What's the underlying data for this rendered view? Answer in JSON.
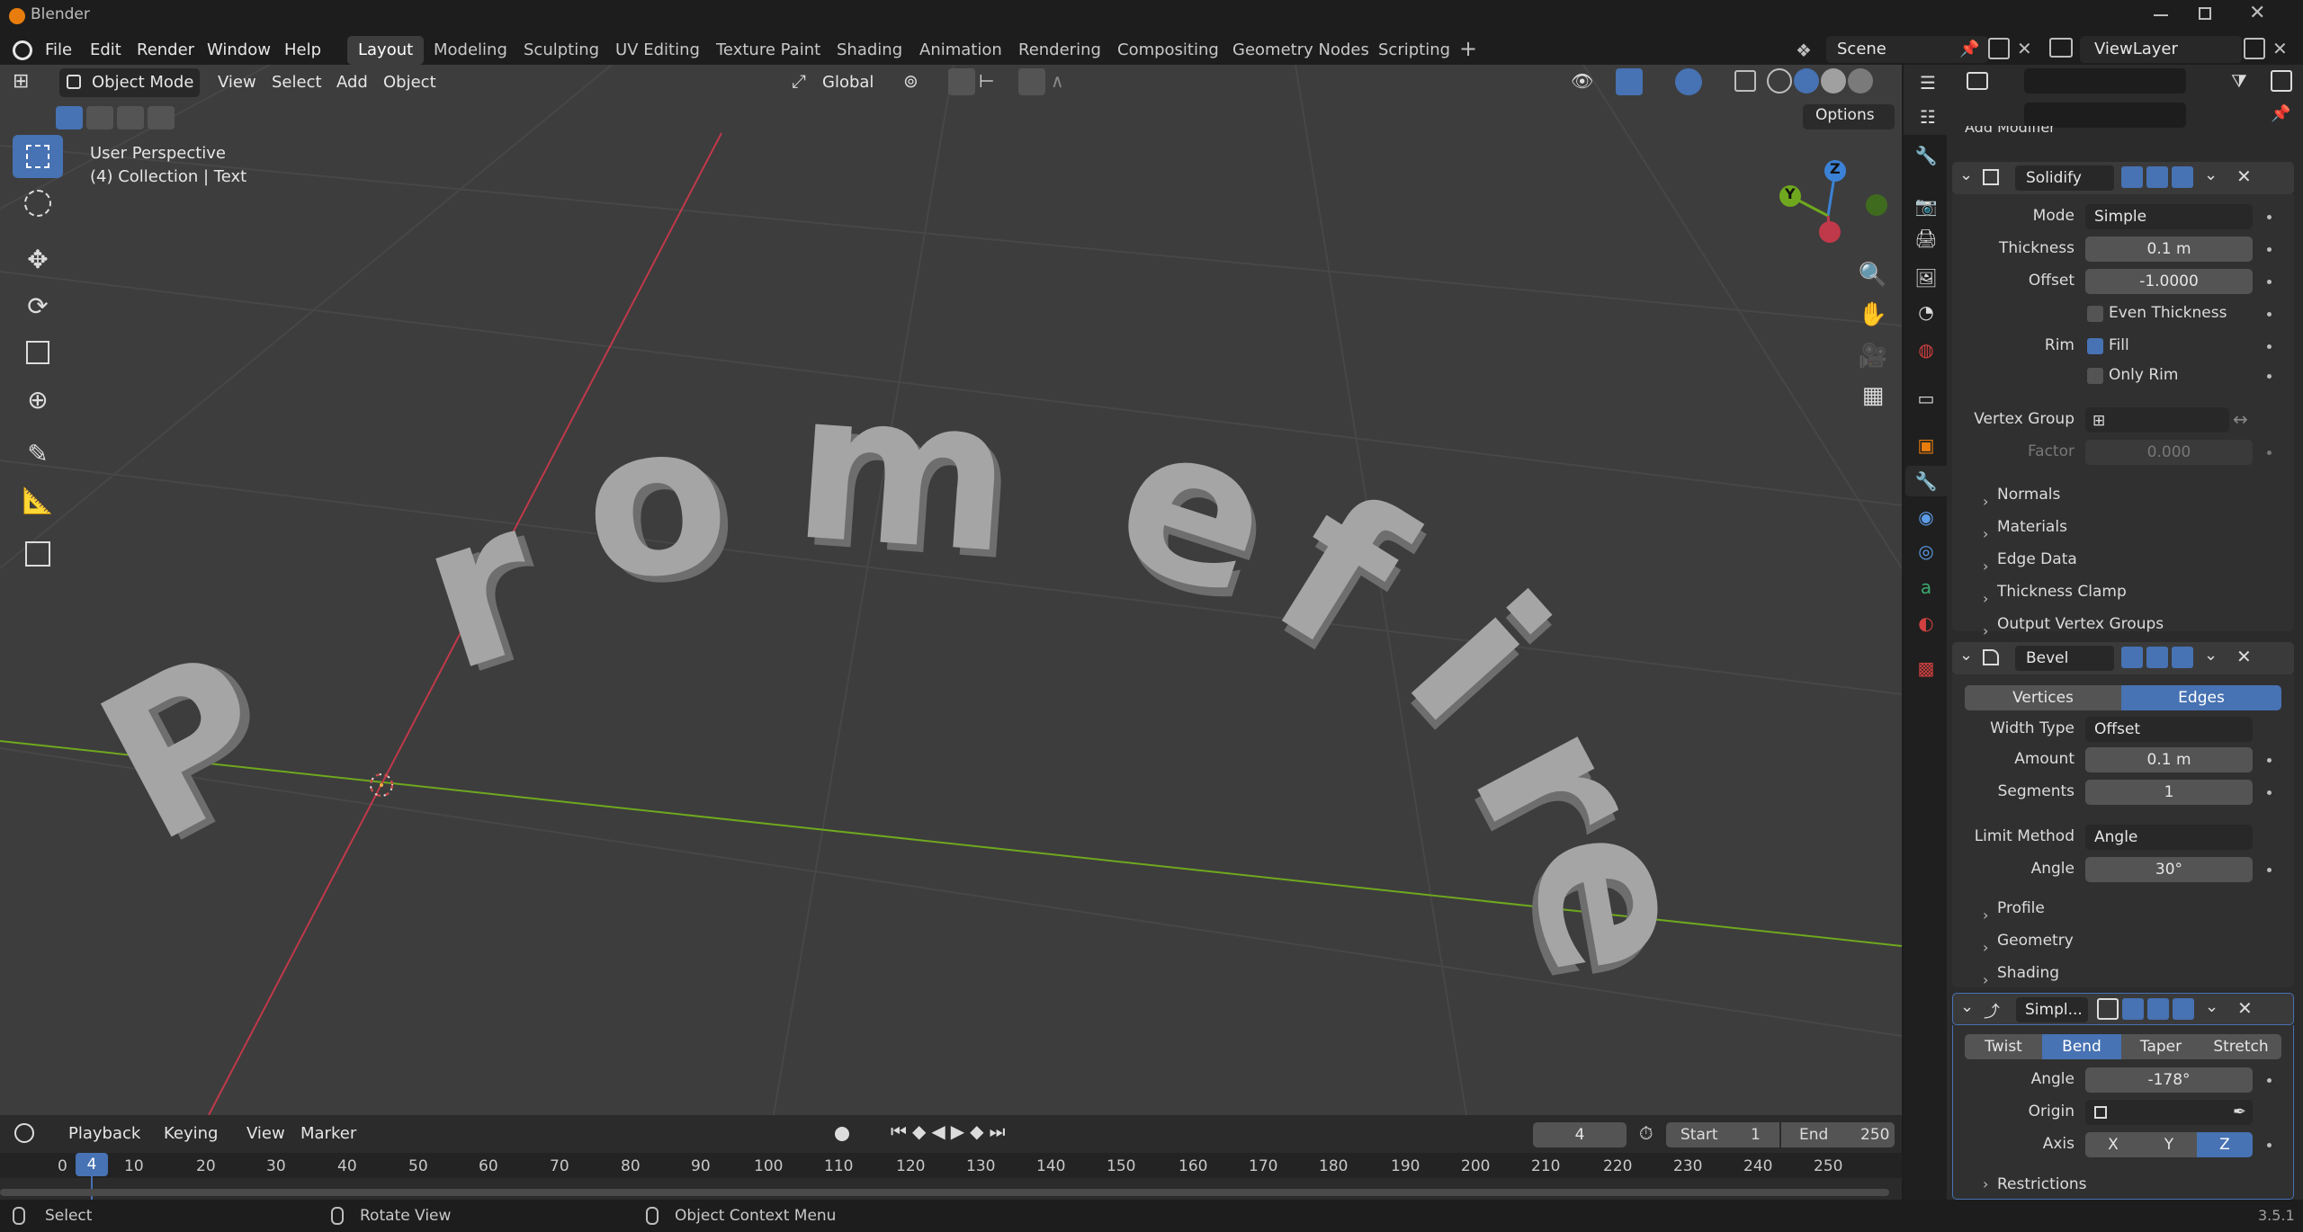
{
  "window": {
    "title": "Blender",
    "version": "3.5.1"
  },
  "menu": {
    "file": "File",
    "edit": "Edit",
    "render": "Render",
    "window": "Window",
    "help": "Help"
  },
  "workspaces": [
    "Layout",
    "Modeling",
    "Sculpting",
    "UV Editing",
    "Texture Paint",
    "Shading",
    "Animation",
    "Rendering",
    "Compositing",
    "Geometry Nodes",
    "Scripting"
  ],
  "active_workspace": "Layout",
  "scene": {
    "name": "Scene",
    "view_layer": "ViewLayer"
  },
  "viewport": {
    "mode": "Object Mode",
    "menu": {
      "view": "View",
      "select": "Select",
      "add": "Add",
      "object": "Object"
    },
    "transform_orientation": "Global",
    "options_label": "Options",
    "perspective_label": "User Perspective",
    "collection_label": "(4) Collection | Text",
    "text_object": "Promefire",
    "gizmo": {
      "z": "Z",
      "y": "Y"
    },
    "axis_colors": {
      "x": "#c0394a",
      "y": "#6fa81e",
      "z": "#3b82d6"
    }
  },
  "properties": {
    "add_modifier": "Add Modifier",
    "solidify": {
      "name": "Solidify",
      "mode_label": "Mode",
      "mode": "Simple",
      "thickness_label": "Thickness",
      "thickness": "0.1 m",
      "offset_label": "Offset",
      "offset": "-1.0000",
      "even_thickness": "Even Thickness",
      "rim_label": "Rim",
      "fill": "Fill",
      "only_rim": "Only Rim",
      "vertex_group_label": "Vertex Group",
      "factor_label": "Factor",
      "factor": "0.000",
      "panels": [
        "Normals",
        "Materials",
        "Edge Data",
        "Thickness Clamp",
        "Output Vertex Groups"
      ]
    },
    "bevel": {
      "name": "Bevel",
      "vertices": "Vertices",
      "edges": "Edges",
      "width_type_label": "Width Type",
      "width_type": "Offset",
      "amount_label": "Amount",
      "amount": "0.1 m",
      "segments_label": "Segments",
      "segments": "1",
      "limit_method_label": "Limit Method",
      "limit_method": "Angle",
      "angle_label": "Angle",
      "angle": "30°",
      "panels": [
        "Profile",
        "Geometry",
        "Shading"
      ]
    },
    "simple_deform": {
      "name": "Simpl...",
      "modes": [
        "Twist",
        "Bend",
        "Taper",
        "Stretch"
      ],
      "active_mode": "Bend",
      "angle_label": "Angle",
      "angle": "-178°",
      "origin_label": "Origin",
      "axis_label": "Axis",
      "axes": [
        "X",
        "Y",
        "Z"
      ],
      "active_axis": "Z",
      "restrictions": "Restrictions"
    }
  },
  "timeline": {
    "playback": "Playback",
    "keying": "Keying",
    "view": "View",
    "marker": "Marker",
    "current_frame": "4",
    "start_label": "Start",
    "start": "1",
    "end_label": "End",
    "end": "250",
    "ruler": [
      "0",
      "4",
      "10",
      "20",
      "30",
      "40",
      "50",
      "60",
      "70",
      "80",
      "90",
      "100",
      "110",
      "120",
      "130",
      "140",
      "150",
      "160",
      "170",
      "180",
      "190",
      "200",
      "210",
      "220",
      "230",
      "240",
      "250"
    ]
  },
  "status": {
    "select": "Select",
    "rotate": "Rotate View",
    "context": "Object Context Menu"
  }
}
